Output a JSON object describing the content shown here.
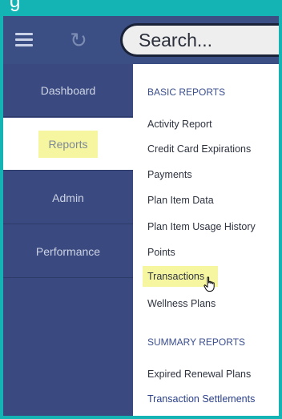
{
  "header": {
    "caption": "g",
    "search_placeholder": "Search..."
  },
  "sidebar": {
    "items": [
      {
        "label": "Dashboard"
      },
      {
        "label": "Reports"
      },
      {
        "label": "Admin"
      },
      {
        "label": "Performance"
      }
    ]
  },
  "content": {
    "basic_heading": "BASIC REPORTS",
    "basic_items": [
      "Activity Report",
      "Credit Card Expirations",
      "Payments",
      "Plan Item Data",
      "Plan Item Usage History",
      "Points",
      "Transactions",
      "Wellness Plans"
    ],
    "summary_heading": "SUMMARY REPORTS",
    "summary_items": [
      "Expired Renewal Plans",
      "Transaction Settlements"
    ]
  },
  "icons": {
    "menu": "hamburger-icon",
    "refresh": "refresh-icon",
    "cursor": "hand-pointer-icon"
  }
}
